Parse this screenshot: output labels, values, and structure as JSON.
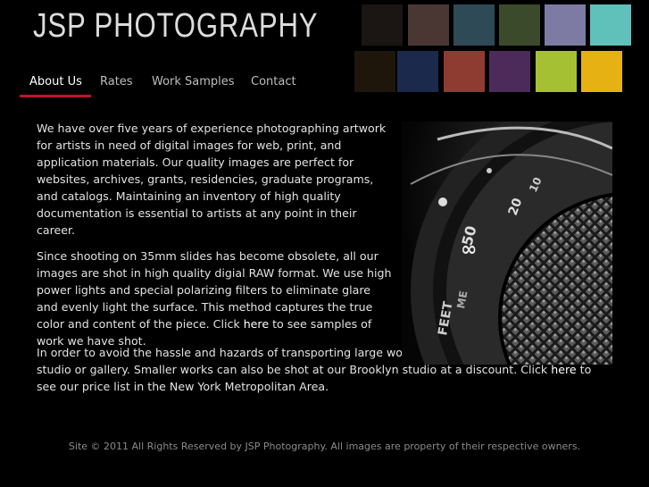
{
  "header": {
    "logo_text": "JSP PHOTOGRAPHY"
  },
  "swatch_colors": {
    "row1": [
      "#1b1614",
      "#4a3733",
      "#2f4a57",
      "#3b4a2a",
      "#7d7aa3",
      "#5fc1b9"
    ],
    "row2": [
      "#1f160b",
      "#1b2a4c",
      "#8e3b32",
      "#4c2b5a",
      "#a6c033",
      "#e6b112"
    ]
  },
  "nav": {
    "accent_color": "#c0132d",
    "items": [
      "About Us",
      "Rates",
      "Work Samples",
      "Contact"
    ],
    "active": "About Us"
  },
  "content": {
    "p1": "We have over five years of experience photographing artwork for artists in need of digital images for web, print, and application materials. Our quality images are perfect for websites, archives, grants, residencies, graduate programs, and catalogs. Maintaining an inventory of high quality documentation is essential to artists at any point in their career.",
    "p2_before": "Since shooting on 35mm slides has become obsolete, all our images are shot in high quality digial RAW format. We use high power lights and special polarizing filters to eliminate glare and evenly light the surface. This method captures the true color and content of the piece. Click ",
    "p2_link": "here",
    "p2_after": " to see samples of work we have shot.",
    "p3_before": "In order to avoid the hassle and hazards of transporting large work, we offer services on-site at your studio or gallery. Smaller works can also be shot at our Brooklyn studio at a discount. Click ",
    "p3_link": "here",
    "p3_after": " to see our price list in the New York Metropolitan Area."
  },
  "photo": {
    "icon": "camera-lens-photo",
    "lens_text": {
      "n1": "50",
      "n2": "20",
      "n3": "10",
      "n4": "FEET",
      "n5": "ME",
      "n6": "∞"
    }
  },
  "footer": {
    "text": "Site © 2011 All Rights Reserved by JSP Photography. All images are property of their respective owners."
  }
}
